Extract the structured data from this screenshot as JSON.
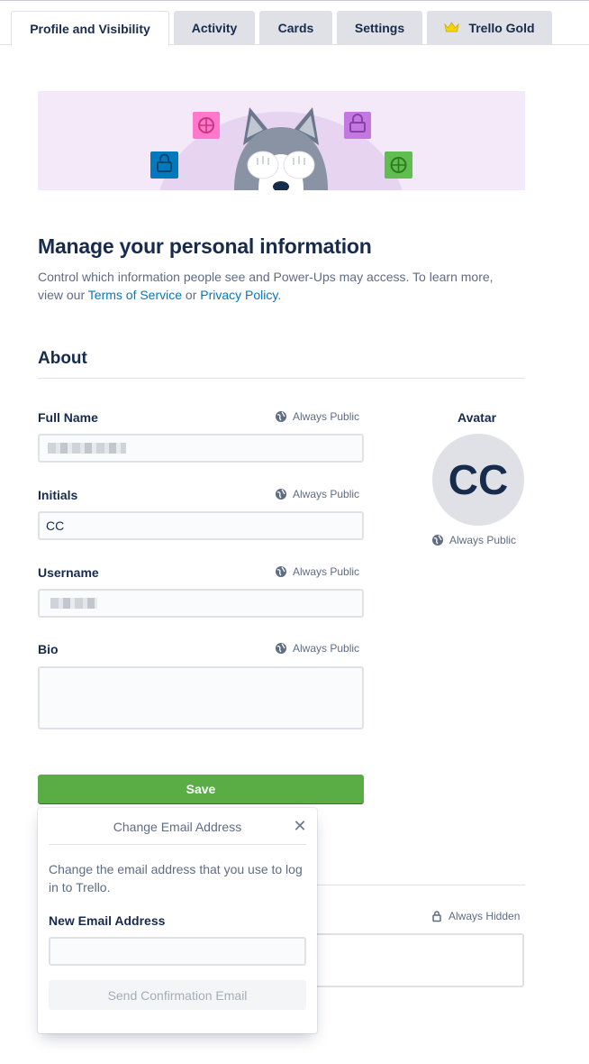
{
  "tabs": [
    {
      "label": "Profile and Visibility",
      "active": true
    },
    {
      "label": "Activity"
    },
    {
      "label": "Cards"
    },
    {
      "label": "Settings"
    },
    {
      "label": "Trello Gold",
      "icon": "crown-icon"
    }
  ],
  "page": {
    "title": "Manage your personal information",
    "intro_text": "Control which information people see and Power-Ups may access. To learn more, view our",
    "terms_link": "Terms of Service",
    "or_text": "or",
    "privacy_link": "Privacy Policy",
    "period": "."
  },
  "about": {
    "section_title": "About",
    "fields": [
      {
        "label": "Full Name",
        "visibility": "Always Public",
        "value": ""
      },
      {
        "label": "Initials",
        "visibility": "Always Public",
        "value": "CC"
      },
      {
        "label": "Username",
        "visibility": "Always Public",
        "value": ""
      },
      {
        "label": "Bio",
        "visibility": "Always Public",
        "value": ""
      }
    ],
    "avatar": {
      "label": "Avatar",
      "initials": "CC",
      "visibility": "Always Public"
    },
    "save_label": "Save"
  },
  "email_section": {
    "visibility": "Always Hidden"
  },
  "popover": {
    "title": "Change Email Address",
    "close_glyph": "✕",
    "description": "Change the email address that you use to log in to Trello.",
    "new_email_label": "New Email Address",
    "new_email_value": "",
    "submit_label": "Send Confirmation Email"
  },
  "colors": {
    "accent_link": "#0079bf",
    "save_green": "#5aac44",
    "banner_bg": "#f3e9f8"
  }
}
